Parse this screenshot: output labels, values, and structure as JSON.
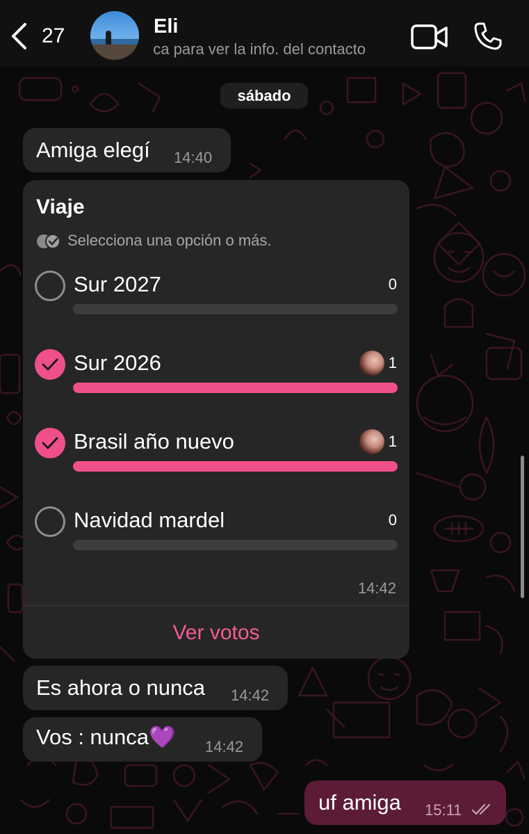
{
  "header": {
    "back_count": "27",
    "contact_name": "Eli",
    "contact_subtitle": "Toca para ver la info. del contacto"
  },
  "date_chip": "sábado",
  "messages": [
    {
      "text": "Amiga elegí",
      "time": "14:40"
    },
    {
      "text": "Es ahora o nunca",
      "time": "14:42"
    },
    {
      "text": "Vos : nunca💜",
      "time": "14:42"
    },
    {
      "text": "uf amiga",
      "time": "15:11",
      "outgoing": true
    }
  ],
  "poll": {
    "title": "Viaje",
    "hint": "Selecciona una opción o más.",
    "options": [
      {
        "label": "Sur 2027",
        "count": "0",
        "checked": false,
        "fraction": 0
      },
      {
        "label": "Sur 2026",
        "count": "1",
        "checked": true,
        "fraction": 1
      },
      {
        "label": "Brasil año nuevo",
        "count": "1",
        "checked": true,
        "fraction": 1
      },
      {
        "label": "Navidad mardel",
        "count": "0",
        "checked": false,
        "fraction": 0
      }
    ],
    "time": "14:42",
    "view_votes": "Ver votos"
  },
  "colors": {
    "accent": "#f0508a",
    "bubble_in": "#262626",
    "bubble_out": "#5c1c38",
    "wallpaper_doodle": "#3a1426"
  },
  "icons": [
    "chevron-left-icon",
    "video-camera-icon",
    "phone-icon",
    "double-check-icon"
  ]
}
